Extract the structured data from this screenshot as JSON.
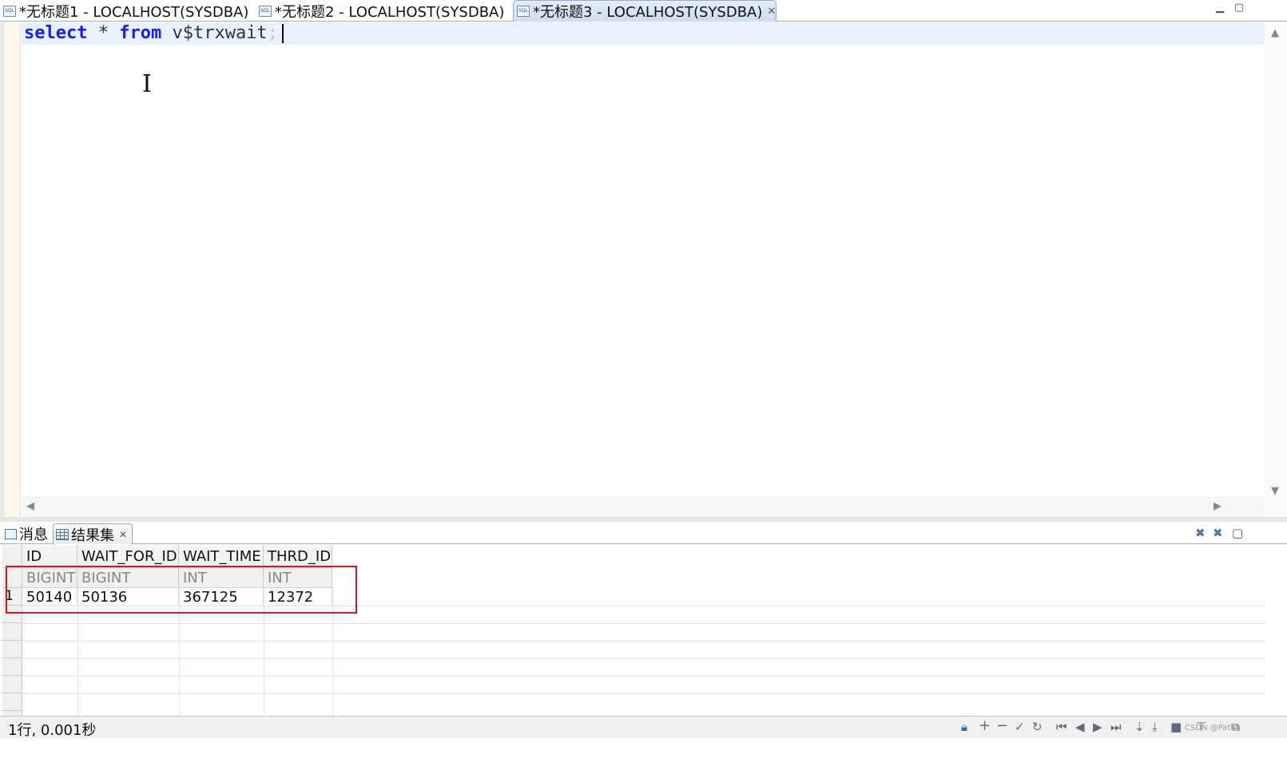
{
  "editor_tabs": [
    {
      "label": "*无标题1 - LOCALHOST(SYSDBA)",
      "active": false
    },
    {
      "label": "*无标题2 - LOCALHOST(SYSDBA)",
      "active": false
    },
    {
      "label": "*无标题3 - LOCALHOST(SYSDBA)",
      "active": true
    }
  ],
  "editor": {
    "keyword_select": "select",
    "star": "*",
    "keyword_from": "from",
    "table_name": "v$trxwait",
    "semicolon": ";"
  },
  "result_tabs": [
    {
      "label": "消息",
      "icon": "message-icon",
      "active": false
    },
    {
      "label": "结果集",
      "icon": "grid-icon",
      "active": true
    }
  ],
  "result_table": {
    "columns": [
      {
        "name": "ID",
        "type": "BIGINT"
      },
      {
        "name": "WAIT_FOR_ID",
        "type": "BIGINT"
      },
      {
        "name": "WAIT_TIME",
        "type": "INT"
      },
      {
        "name": "THRD_ID",
        "type": "INT"
      }
    ],
    "rows": [
      {
        "row_number": "1",
        "values": [
          "50140",
          "50136",
          "367125",
          "12372"
        ]
      }
    ]
  },
  "status": {
    "text": "1行, 0.001秒",
    "watermark": "CSDN @Paton"
  },
  "colors": {
    "keyword": "#1a1aff",
    "highlight_box": "#e0161e",
    "active_tab": "#cddcf0"
  }
}
